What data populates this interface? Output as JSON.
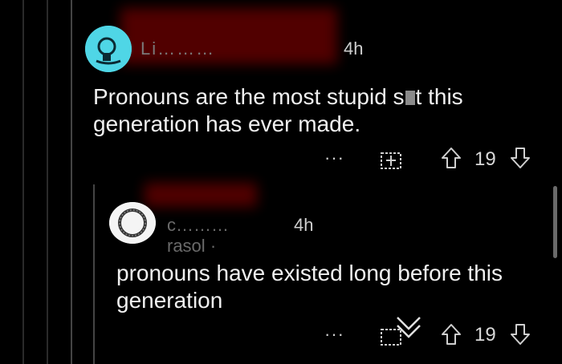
{
  "comments": [
    {
      "username": "Li………",
      "time": "4h",
      "body_before": "Pronouns are the most stupid s",
      "body_after": "t this generation has ever made.",
      "upvotes": "19",
      "more": "···"
    },
    {
      "username": "c………rasol",
      "separator": "·",
      "time": "4h",
      "body": "pronouns have existed long before this generation",
      "upvotes": "19",
      "more": "···"
    }
  ],
  "icons": {
    "award": "gift-box-icon",
    "upvote": "arrow-up-icon",
    "downvote": "arrow-down-icon",
    "collapse": "chevron-down-icon"
  },
  "colors": {
    "background": "#000000",
    "text": "#f0f0f0",
    "avatar1": "#4fd6e6",
    "redaction": "#5a0000"
  }
}
